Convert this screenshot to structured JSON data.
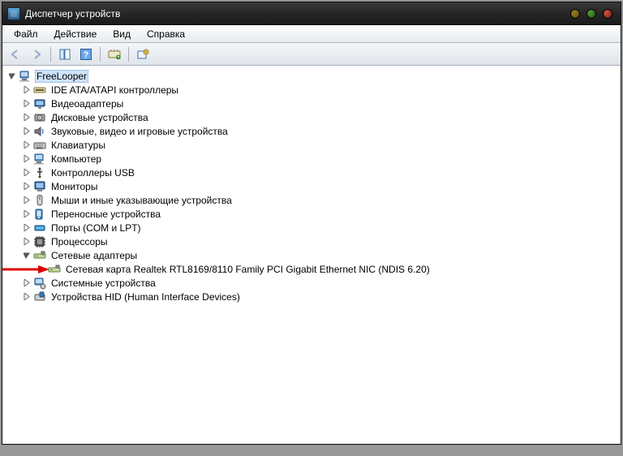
{
  "window": {
    "title": "Диспетчер устройств"
  },
  "menubar": {
    "file": "Файл",
    "action": "Действие",
    "view": "Вид",
    "help": "Справка"
  },
  "tree": {
    "root": {
      "label": "FreeLooper"
    },
    "categories": [
      {
        "label": "IDE ATA/ATAPI контроллеры",
        "icon": "ide",
        "expanded": false
      },
      {
        "label": "Видеоадаптеры",
        "icon": "display",
        "expanded": false
      },
      {
        "label": "Дисковые устройства",
        "icon": "disk",
        "expanded": false
      },
      {
        "label": "Звуковые, видео и игровые устройства",
        "icon": "sound",
        "expanded": false
      },
      {
        "label": "Клавиатуры",
        "icon": "keyboard",
        "expanded": false
      },
      {
        "label": "Компьютер",
        "icon": "computer",
        "expanded": false
      },
      {
        "label": "Контроллеры USB",
        "icon": "usb",
        "expanded": false
      },
      {
        "label": "Мониторы",
        "icon": "monitor",
        "expanded": false
      },
      {
        "label": "Мыши и иные указывающие устройства",
        "icon": "mouse",
        "expanded": false
      },
      {
        "label": "Переносные устройства",
        "icon": "portable",
        "expanded": false
      },
      {
        "label": "Порты (COM и LPT)",
        "icon": "port",
        "expanded": false
      },
      {
        "label": "Процессоры",
        "icon": "cpu",
        "expanded": false
      },
      {
        "label": "Сетевые адаптеры",
        "icon": "network",
        "expanded": true,
        "children": [
          {
            "label": "Сетевая карта Realtek RTL8169/8110 Family PCI Gigabit Ethernet NIC (NDIS 6.20)",
            "icon": "nic",
            "highlight": true
          }
        ]
      },
      {
        "label": "Системные устройства",
        "icon": "system",
        "expanded": false
      },
      {
        "label": "Устройства HID (Human Interface Devices)",
        "icon": "hid",
        "expanded": false
      }
    ]
  }
}
